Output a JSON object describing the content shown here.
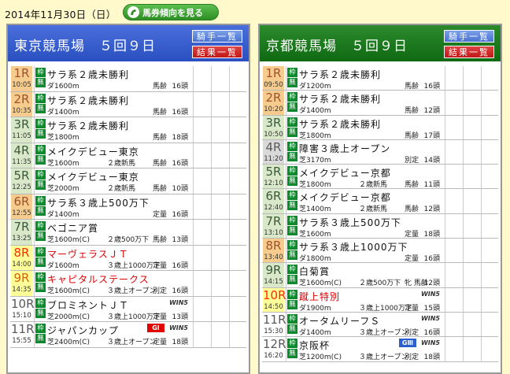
{
  "topbar": {
    "date": "2014年11月30日（日）",
    "trend_button": "馬券傾向を見る"
  },
  "venues": [
    {
      "title": "東京競馬場　５回９日",
      "jockey_button": "騎手一覧",
      "results_button": "結果一覧",
      "races": [
        {
          "num": "1R",
          "time": "10:05",
          "name": "サラ系２歳未勝利",
          "detail": "ダ1600m",
          "cond": "",
          "weight": "馬齢",
          "heads": "16頭",
          "color": "orange",
          "hl": false,
          "red": false,
          "grade": "",
          "win5": false
        },
        {
          "num": "2R",
          "time": "10:35",
          "name": "サラ系２歳未勝利",
          "detail": "ダ1400m",
          "cond": "",
          "weight": "馬齢",
          "heads": "16頭",
          "color": "orange",
          "hl": false,
          "red": false,
          "grade": "",
          "win5": false
        },
        {
          "num": "3R",
          "time": "11:05",
          "name": "サラ系２歳未勝利",
          "detail": "芝1800m",
          "cond": "",
          "weight": "馬齢",
          "heads": "18頭",
          "color": "green",
          "hl": false,
          "red": false,
          "grade": "",
          "win5": false
        },
        {
          "num": "4R",
          "time": "11:35",
          "name": "メイクデビュー東京",
          "detail": "芝1600m",
          "cond": "２歳新馬",
          "weight": "馬齢",
          "heads": "16頭",
          "color": "green",
          "hl": false,
          "red": false,
          "grade": "",
          "win5": false
        },
        {
          "num": "5R",
          "time": "12:25",
          "name": "メイクデビュー東京",
          "detail": "芝2000m",
          "cond": "２歳新馬",
          "weight": "馬齢",
          "heads": "10頭",
          "color": "green",
          "hl": false,
          "red": false,
          "grade": "",
          "win5": false
        },
        {
          "num": "6R",
          "time": "12:55",
          "name": "サラ系３歳上500万下",
          "detail": "ダ1400m",
          "cond": "",
          "weight": "定量",
          "heads": "16頭",
          "color": "orange",
          "hl": false,
          "red": false,
          "grade": "",
          "win5": false
        },
        {
          "num": "7R",
          "time": "13:25",
          "name": "ベゴニア賞",
          "detail": "芝1600m(C)",
          "cond": "２歳500万下",
          "weight": "馬齢",
          "heads": "13頭",
          "color": "green",
          "hl": false,
          "red": false,
          "grade": "",
          "win5": false
        },
        {
          "num": "8R",
          "time": "14:00",
          "name": "マーヴェラスＪＴ",
          "detail": "ダ1600m",
          "cond": "３歳上1000万下",
          "weight": "定量",
          "heads": "16頭",
          "color": "yellow",
          "hl": true,
          "red": true,
          "grade": "",
          "win5": false
        },
        {
          "num": "9R",
          "time": "14:35",
          "name": "キャピタルステークス",
          "detail": "芝1600m(C)",
          "cond": "３歳上オープン",
          "weight": "別定",
          "heads": "16頭",
          "color": "yellow",
          "hl": false,
          "red": true,
          "grade": "",
          "win5": false
        },
        {
          "num": "10R",
          "time": "15:10",
          "name": "ブロミネントＪＴ",
          "detail": "芝2000m(C)",
          "cond": "３歳上1000万下",
          "weight": "定量",
          "heads": "13頭",
          "color": "white",
          "hl": false,
          "red": false,
          "grade": "",
          "win5": true
        },
        {
          "num": "11R",
          "time": "15:55",
          "name": "ジャパンカップ",
          "detail": "芝2400m(C)",
          "cond": "３歳上オープン",
          "weight": "定量",
          "heads": "18頭",
          "color": "white",
          "hl": false,
          "red": false,
          "grade": "GⅠ",
          "win5": true
        }
      ]
    },
    {
      "title": "京都競馬場　５回９日",
      "jockey_button": "騎手一覧",
      "results_button": "結果一覧",
      "races": [
        {
          "num": "1R",
          "time": "09:50",
          "name": "サラ系２歳未勝利",
          "detail": "ダ1200m",
          "cond": "",
          "weight": "馬齢",
          "heads": "16頭",
          "color": "orange",
          "hl": false,
          "red": false,
          "grade": "",
          "win5": false
        },
        {
          "num": "2R",
          "time": "10:20",
          "name": "サラ系２歳未勝利",
          "detail": "ダ1400m",
          "cond": "",
          "weight": "馬齢",
          "heads": "12頭",
          "color": "orange",
          "hl": false,
          "red": false,
          "grade": "",
          "win5": false
        },
        {
          "num": "3R",
          "time": "10:50",
          "name": "サラ系２歳未勝利",
          "detail": "芝1800m",
          "cond": "",
          "weight": "馬齢",
          "heads": "17頭",
          "color": "green",
          "hl": false,
          "red": false,
          "grade": "",
          "win5": false
        },
        {
          "num": "4R",
          "time": "11:20",
          "name": "障害３歳上オープン",
          "detail": "芝3170m",
          "cond": "",
          "weight": "別定",
          "heads": "14頭",
          "color": "gray",
          "hl": false,
          "red": false,
          "grade": "",
          "win5": false
        },
        {
          "num": "5R",
          "time": "12:10",
          "name": "メイクデビュー京都",
          "detail": "芝1800m",
          "cond": "２歳新馬",
          "weight": "馬齢",
          "heads": "11頭",
          "color": "green",
          "hl": false,
          "red": false,
          "grade": "",
          "win5": false
        },
        {
          "num": "6R",
          "time": "12:40",
          "name": "メイクデビュー京都",
          "detail": "芝1400m",
          "cond": "２歳新馬",
          "weight": "馬齢",
          "heads": "12頭",
          "color": "green",
          "hl": false,
          "red": false,
          "grade": "",
          "win5": false
        },
        {
          "num": "7R",
          "time": "13:10",
          "name": "サラ系３歳上500万下",
          "detail": "芝1600m",
          "cond": "",
          "weight": "定量",
          "heads": "18頭",
          "color": "green",
          "hl": false,
          "red": false,
          "grade": "",
          "win5": false
        },
        {
          "num": "8R",
          "time": "13:40",
          "name": "サラ系３歳上1000万下",
          "detail": "ダ1800m",
          "cond": "",
          "weight": "定量",
          "heads": "16頭",
          "color": "orange",
          "hl": false,
          "red": false,
          "grade": "",
          "win5": false
        },
        {
          "num": "9R",
          "time": "14:15",
          "name": "白菊賞",
          "detail": "芝1600m(C)",
          "cond": "２歳500万下",
          "weight": "牝 馬齢",
          "heads": "12頭",
          "color": "green",
          "hl": false,
          "red": false,
          "grade": "",
          "win5": false
        },
        {
          "num": "10R",
          "time": "14:50",
          "name": "蹴上特別",
          "detail": "ダ1900m",
          "cond": "３歳上1000万下",
          "weight": "定量",
          "heads": "15頭",
          "color": "yellow",
          "hl": true,
          "red": true,
          "grade": "",
          "win5": true
        },
        {
          "num": "11R",
          "time": "15:30",
          "name": "オータムリーフＳ",
          "detail": "ダ1400m",
          "cond": "３歳上オープン",
          "weight": "別定",
          "heads": "16頭",
          "color": "white",
          "hl": false,
          "red": false,
          "grade": "",
          "win5": true
        },
        {
          "num": "12R",
          "time": "16:20",
          "name": "京阪杯",
          "detail": "芝1200m(C)",
          "cond": "３歳上オープン",
          "weight": "別定",
          "heads": "18頭",
          "color": "white",
          "hl": false,
          "red": false,
          "grade": "GⅢ",
          "win5": true
        }
      ]
    }
  ],
  "badges": {
    "waku": "枠",
    "muryo": "無"
  },
  "win5_label": "WIN5"
}
